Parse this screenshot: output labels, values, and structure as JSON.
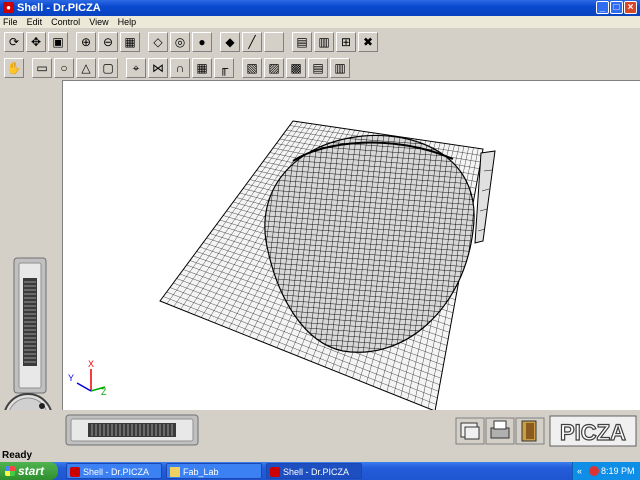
{
  "window": {
    "title": "Shell - Dr.PICZA"
  },
  "menu": [
    "File",
    "Edit",
    "Control",
    "View",
    "Help"
  ],
  "toolbar1": [
    {
      "name": "rotate-tool-button",
      "icon": "rotate-icon",
      "glyph": "⟳"
    },
    {
      "name": "move-tool-button",
      "icon": "move-icon",
      "glyph": "✥"
    },
    {
      "name": "cube-tool-button",
      "icon": "cube-icon",
      "glyph": "▣"
    },
    {
      "name": "zoom-in-button",
      "icon": "zoom-in-icon",
      "glyph": "⊕"
    },
    {
      "name": "zoom-out-button",
      "icon": "zoom-out-icon",
      "glyph": "⊖"
    },
    {
      "name": "fit-view-button",
      "icon": "fit-view-icon",
      "glyph": "▦"
    },
    {
      "name": "wireframe-view-button",
      "icon": "wireframe-cube-icon",
      "glyph": "◇"
    },
    {
      "name": "surface-view-button",
      "icon": "surface-icon",
      "glyph": "◎"
    },
    {
      "name": "shaded-view-button",
      "icon": "sphere-icon",
      "glyph": "●"
    },
    {
      "name": "paint-bucket-button",
      "icon": "paint-bucket-icon",
      "glyph": "◆"
    },
    {
      "name": "brush-button",
      "icon": "brush-icon",
      "glyph": "╱"
    },
    {
      "name": "blank-button",
      "icon": "blank-icon",
      "glyph": ""
    },
    {
      "name": "grid-settings-button",
      "icon": "grid-settings-icon",
      "glyph": "▤"
    },
    {
      "name": "print-preview-button",
      "icon": "print-preview-icon",
      "glyph": "▥"
    },
    {
      "name": "measure-button",
      "icon": "measure-icon",
      "glyph": "⊞"
    },
    {
      "name": "tools-button",
      "icon": "tools-icon",
      "glyph": "✖"
    }
  ],
  "toolbar2": [
    {
      "name": "hand-tool-button",
      "icon": "hand-icon",
      "glyph": "✋"
    },
    {
      "name": "select-rect-button",
      "icon": "select-rect-icon",
      "glyph": "▭"
    },
    {
      "name": "select-circle-button",
      "icon": "select-circle-icon",
      "glyph": "○"
    },
    {
      "name": "select-poly-button",
      "icon": "select-poly-icon",
      "glyph": "△"
    },
    {
      "name": "select-all-button",
      "icon": "select-all-icon",
      "glyph": "▢"
    },
    {
      "name": "cut-shape-button",
      "icon": "cut-shape-icon",
      "glyph": "⌖"
    },
    {
      "name": "mirror-button",
      "icon": "mirror-icon",
      "glyph": "⋈"
    },
    {
      "name": "arch-button",
      "icon": "arch-icon",
      "glyph": "∩"
    },
    {
      "name": "grid-button",
      "icon": "grid-icon",
      "glyph": "▦"
    },
    {
      "name": "frame-button",
      "icon": "frame-icon",
      "glyph": "╓"
    },
    {
      "name": "box-view-1-button",
      "icon": "box-icon",
      "glyph": "▧"
    },
    {
      "name": "box-view-2-button",
      "icon": "box-icon",
      "glyph": "▨"
    },
    {
      "name": "box-view-3-button",
      "icon": "box-icon",
      "glyph": "▩"
    },
    {
      "name": "box-view-4-button",
      "icon": "box-icon",
      "glyph": "▤"
    },
    {
      "name": "box-view-5-button",
      "icon": "box-icon",
      "glyph": "▥"
    }
  ],
  "axes": {
    "x": "X",
    "y": "Y",
    "z": "Z"
  },
  "bottom": {
    "logo": "PICZA"
  },
  "status": {
    "text": "Ready"
  },
  "taskbar": {
    "start": "start",
    "tasks": [
      {
        "label": "Shell - Dr.PICZA",
        "active": false
      },
      {
        "label": "Fab_Lab",
        "active": false
      },
      {
        "label": "Shell - Dr.PICZA",
        "active": true
      }
    ],
    "clock": "8:19 PM"
  }
}
